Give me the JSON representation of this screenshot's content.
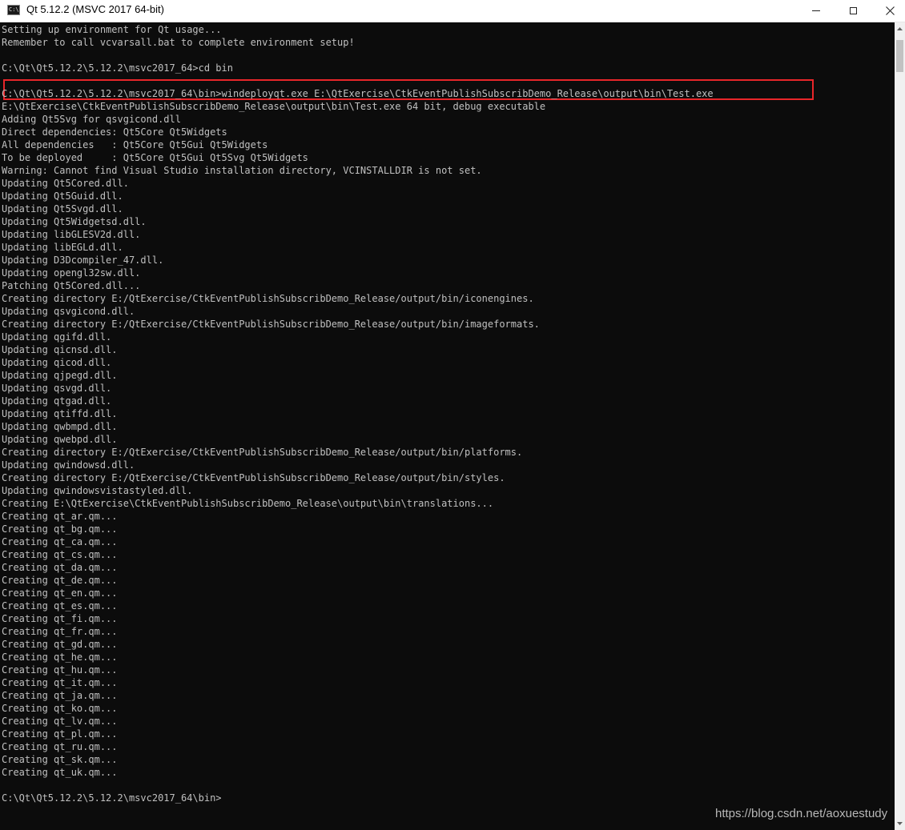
{
  "window": {
    "title": "Qt 5.12.2 (MSVC 2017 64-bit)",
    "icon_name": "console-icon",
    "icon_text": "C:\\",
    "controls": [
      "minimize-icon",
      "maximize-icon",
      "close-icon"
    ]
  },
  "console": {
    "text_color": "#c0c0c0",
    "background": "#0c0c0c",
    "highlight_color": "#e8262a",
    "lines": [
      "Setting up environment for Qt usage...",
      "Remember to call vcvarsall.bat to complete environment setup!",
      "",
      "C:\\Qt\\Qt5.12.2\\5.12.2\\msvc2017_64>cd bin",
      "",
      "C:\\Qt\\Qt5.12.2\\5.12.2\\msvc2017_64\\bin>windeployqt.exe E:\\QtExercise\\CtkEventPublishSubscribDemo_Release\\output\\bin\\Test.exe",
      "E:\\QtExercise\\CtkEventPublishSubscribDemo_Release\\output\\bin\\Test.exe 64 bit, debug executable",
      "Adding Qt5Svg for qsvgicond.dll",
      "Direct dependencies: Qt5Core Qt5Widgets",
      "All dependencies   : Qt5Core Qt5Gui Qt5Widgets",
      "To be deployed     : Qt5Core Qt5Gui Qt5Svg Qt5Widgets",
      "Warning: Cannot find Visual Studio installation directory, VCINSTALLDIR is not set.",
      "Updating Qt5Cored.dll.",
      "Updating Qt5Guid.dll.",
      "Updating Qt5Svgd.dll.",
      "Updating Qt5Widgetsd.dll.",
      "Updating libGLESV2d.dll.",
      "Updating libEGLd.dll.",
      "Updating D3Dcompiler_47.dll.",
      "Updating opengl32sw.dll.",
      "Patching Qt5Cored.dll...",
      "Creating directory E:/QtExercise/CtkEventPublishSubscribDemo_Release/output/bin/iconengines.",
      "Updating qsvgicond.dll.",
      "Creating directory E:/QtExercise/CtkEventPublishSubscribDemo_Release/output/bin/imageformats.",
      "Updating qgifd.dll.",
      "Updating qicnsd.dll.",
      "Updating qicod.dll.",
      "Updating qjpegd.dll.",
      "Updating qsvgd.dll.",
      "Updating qtgad.dll.",
      "Updating qtiffd.dll.",
      "Updating qwbmpd.dll.",
      "Updating qwebpd.dll.",
      "Creating directory E:/QtExercise/CtkEventPublishSubscribDemo_Release/output/bin/platforms.",
      "Updating qwindowsd.dll.",
      "Creating directory E:/QtExercise/CtkEventPublishSubscribDemo_Release/output/bin/styles.",
      "Updating qwindowsvistastyled.dll.",
      "Creating E:\\QtExercise\\CtkEventPublishSubscribDemo_Release\\output\\bin\\translations...",
      "Creating qt_ar.qm...",
      "Creating qt_bg.qm...",
      "Creating qt_ca.qm...",
      "Creating qt_cs.qm...",
      "Creating qt_da.qm...",
      "Creating qt_de.qm...",
      "Creating qt_en.qm...",
      "Creating qt_es.qm...",
      "Creating qt_fi.qm...",
      "Creating qt_fr.qm...",
      "Creating qt_gd.qm...",
      "Creating qt_he.qm...",
      "Creating qt_hu.qm...",
      "Creating qt_it.qm...",
      "Creating qt_ja.qm...",
      "Creating qt_ko.qm...",
      "Creating qt_lv.qm...",
      "Creating qt_pl.qm...",
      "Creating qt_ru.qm...",
      "Creating qt_sk.qm...",
      "Creating qt_uk.qm...",
      "",
      "C:\\Qt\\Qt5.12.2\\5.12.2\\msvc2017_64\\bin>"
    ]
  },
  "watermark": "https://blog.csdn.net/aoxuestudy"
}
